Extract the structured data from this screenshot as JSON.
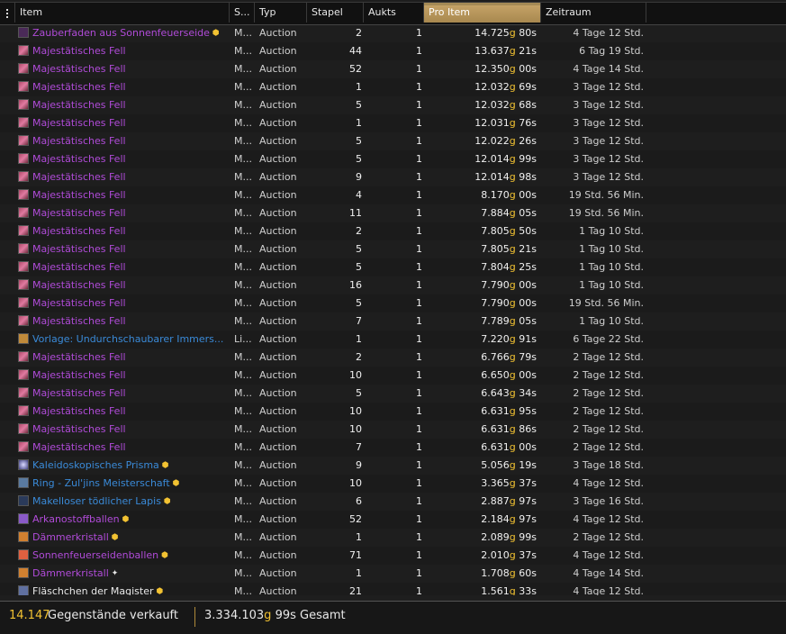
{
  "columns": {
    "item": "Item",
    "s": "S...",
    "typ": "Typ",
    "stapel": "Stapel",
    "aukts": "Aukts",
    "pro_item": "Pro Item",
    "zeitraum": "Zeitraum"
  },
  "gold_symbol": "g",
  "rows": [
    {
      "name": "Zauberfaden aus Sonnenfeuerseide",
      "quality": "epic",
      "icon": "thread-icon",
      "star": "gold",
      "s": "M...",
      "typ": "Auction",
      "stapel": "2",
      "aukts": "1",
      "gold": "14.725",
      "silver": "80s",
      "zeit": "4 Tage 12 Std."
    },
    {
      "name": "Majestätisches Fell",
      "quality": "epic",
      "icon": "fur-icon",
      "star": "",
      "s": "M...",
      "typ": "Auction",
      "stapel": "44",
      "aukts": "1",
      "gold": "13.637",
      "silver": "21s",
      "zeit": "6 Tag 19 Std."
    },
    {
      "name": "Majestätisches Fell",
      "quality": "epic",
      "icon": "fur-icon",
      "star": "",
      "s": "M...",
      "typ": "Auction",
      "stapel": "52",
      "aukts": "1",
      "gold": "12.350",
      "silver": "00s",
      "zeit": "4 Tage 14 Std."
    },
    {
      "name": "Majestätisches Fell",
      "quality": "epic",
      "icon": "fur-icon",
      "star": "",
      "s": "M...",
      "typ": "Auction",
      "stapel": "1",
      "aukts": "1",
      "gold": "12.032",
      "silver": "69s",
      "zeit": "3 Tage 12 Std."
    },
    {
      "name": "Majestätisches Fell",
      "quality": "epic",
      "icon": "fur-icon",
      "star": "",
      "s": "M...",
      "typ": "Auction",
      "stapel": "5",
      "aukts": "1",
      "gold": "12.032",
      "silver": "68s",
      "zeit": "3 Tage 12 Std."
    },
    {
      "name": "Majestätisches Fell",
      "quality": "epic",
      "icon": "fur-icon",
      "star": "",
      "s": "M...",
      "typ": "Auction",
      "stapel": "1",
      "aukts": "1",
      "gold": "12.031",
      "silver": "76s",
      "zeit": "3 Tage 12 Std."
    },
    {
      "name": "Majestätisches Fell",
      "quality": "epic",
      "icon": "fur-icon",
      "star": "",
      "s": "M...",
      "typ": "Auction",
      "stapel": "5",
      "aukts": "1",
      "gold": "12.022",
      "silver": "26s",
      "zeit": "3 Tage 12 Std."
    },
    {
      "name": "Majestätisches Fell",
      "quality": "epic",
      "icon": "fur-icon",
      "star": "",
      "s": "M...",
      "typ": "Auction",
      "stapel": "5",
      "aukts": "1",
      "gold": "12.014",
      "silver": "99s",
      "zeit": "3 Tage 12 Std."
    },
    {
      "name": "Majestätisches Fell",
      "quality": "epic",
      "icon": "fur-icon",
      "star": "",
      "s": "M...",
      "typ": "Auction",
      "stapel": "9",
      "aukts": "1",
      "gold": "12.014",
      "silver": "98s",
      "zeit": "3 Tage 12 Std."
    },
    {
      "name": "Majestätisches Fell",
      "quality": "epic",
      "icon": "fur-icon",
      "star": "",
      "s": "M...",
      "typ": "Auction",
      "stapel": "4",
      "aukts": "1",
      "gold": "8.170",
      "silver": "00s",
      "zeit": "19 Std. 56 Min."
    },
    {
      "name": "Majestätisches Fell",
      "quality": "epic",
      "icon": "fur-icon",
      "star": "",
      "s": "M...",
      "typ": "Auction",
      "stapel": "11",
      "aukts": "1",
      "gold": "7.884",
      "silver": "05s",
      "zeit": "19 Std. 56 Min."
    },
    {
      "name": "Majestätisches Fell",
      "quality": "epic",
      "icon": "fur-icon",
      "star": "",
      "s": "M...",
      "typ": "Auction",
      "stapel": "2",
      "aukts": "1",
      "gold": "7.805",
      "silver": "50s",
      "zeit": "1 Tag 10 Std."
    },
    {
      "name": "Majestätisches Fell",
      "quality": "epic",
      "icon": "fur-icon",
      "star": "",
      "s": "M...",
      "typ": "Auction",
      "stapel": "5",
      "aukts": "1",
      "gold": "7.805",
      "silver": "21s",
      "zeit": "1 Tag 10 Std."
    },
    {
      "name": "Majestätisches Fell",
      "quality": "epic",
      "icon": "fur-icon",
      "star": "",
      "s": "M...",
      "typ": "Auction",
      "stapel": "5",
      "aukts": "1",
      "gold": "7.804",
      "silver": "25s",
      "zeit": "1 Tag 10 Std."
    },
    {
      "name": "Majestätisches Fell",
      "quality": "epic",
      "icon": "fur-icon",
      "star": "",
      "s": "M...",
      "typ": "Auction",
      "stapel": "16",
      "aukts": "1",
      "gold": "7.790",
      "silver": "00s",
      "zeit": "1 Tag 10 Std."
    },
    {
      "name": "Majestätisches Fell",
      "quality": "epic",
      "icon": "fur-icon",
      "star": "",
      "s": "M...",
      "typ": "Auction",
      "stapel": "5",
      "aukts": "1",
      "gold": "7.790",
      "silver": "00s",
      "zeit": "19 Std. 56 Min."
    },
    {
      "name": "Majestätisches Fell",
      "quality": "epic",
      "icon": "fur-icon",
      "star": "",
      "s": "M...",
      "typ": "Auction",
      "stapel": "7",
      "aukts": "1",
      "gold": "7.789",
      "silver": "05s",
      "zeit": "1 Tag 10 Std."
    },
    {
      "name": "Vorlage: Undurchschaubarer Immers...",
      "quality": "rare",
      "icon": "recipe-icon",
      "star": "",
      "s": "Li...",
      "typ": "Auction",
      "stapel": "1",
      "aukts": "1",
      "gold": "7.220",
      "silver": "91s",
      "zeit": "6 Tage 22 Std."
    },
    {
      "name": "Majestätisches Fell",
      "quality": "epic",
      "icon": "fur-icon",
      "star": "",
      "s": "M...",
      "typ": "Auction",
      "stapel": "2",
      "aukts": "1",
      "gold": "6.766",
      "silver": "79s",
      "zeit": "2 Tage 12 Std."
    },
    {
      "name": "Majestätisches Fell",
      "quality": "epic",
      "icon": "fur-icon",
      "star": "",
      "s": "M...",
      "typ": "Auction",
      "stapel": "10",
      "aukts": "1",
      "gold": "6.650",
      "silver": "00s",
      "zeit": "2 Tage 12 Std."
    },
    {
      "name": "Majestätisches Fell",
      "quality": "epic",
      "icon": "fur-icon",
      "star": "",
      "s": "M...",
      "typ": "Auction",
      "stapel": "5",
      "aukts": "1",
      "gold": "6.643",
      "silver": "34s",
      "zeit": "2 Tage 12 Std."
    },
    {
      "name": "Majestätisches Fell",
      "quality": "epic",
      "icon": "fur-icon",
      "star": "",
      "s": "M...",
      "typ": "Auction",
      "stapel": "10",
      "aukts": "1",
      "gold": "6.631",
      "silver": "95s",
      "zeit": "2 Tage 12 Std."
    },
    {
      "name": "Majestätisches Fell",
      "quality": "epic",
      "icon": "fur-icon",
      "star": "",
      "s": "M...",
      "typ": "Auction",
      "stapel": "10",
      "aukts": "1",
      "gold": "6.631",
      "silver": "86s",
      "zeit": "2 Tage 12 Std."
    },
    {
      "name": "Majestätisches Fell",
      "quality": "epic",
      "icon": "fur-icon",
      "star": "",
      "s": "M...",
      "typ": "Auction",
      "stapel": "7",
      "aukts": "1",
      "gold": "6.631",
      "silver": "00s",
      "zeit": "2 Tage 12 Std."
    },
    {
      "name": "Kaleidoskopisches Prisma",
      "quality": "rare",
      "icon": "prism-icon",
      "star": "gold",
      "s": "M...",
      "typ": "Auction",
      "stapel": "9",
      "aukts": "1",
      "gold": "5.056",
      "silver": "19s",
      "zeit": "3 Tage 18 Std."
    },
    {
      "name": "Ring - Zul'jins Meisterschaft",
      "quality": "rare",
      "icon": "ring-icon",
      "star": "gold",
      "s": "M...",
      "typ": "Auction",
      "stapel": "10",
      "aukts": "1",
      "gold": "3.365",
      "silver": "37s",
      "zeit": "4 Tage 12 Std."
    },
    {
      "name": "Makelloser tödlicher Lapis",
      "quality": "rare",
      "icon": "gem-icon",
      "star": "gold",
      "s": "M...",
      "typ": "Auction",
      "stapel": "6",
      "aukts": "1",
      "gold": "2.887",
      "silver": "97s",
      "zeit": "3 Tage 16 Std."
    },
    {
      "name": "Arkanostoffballen",
      "quality": "epic",
      "icon": "cloth-icon",
      "star": "gold",
      "s": "M...",
      "typ": "Auction",
      "stapel": "52",
      "aukts": "1",
      "gold": "2.184",
      "silver": "97s",
      "zeit": "4 Tage 12 Std."
    },
    {
      "name": "Dämmerkristall",
      "quality": "epic",
      "icon": "crystal-icon",
      "star": "gold",
      "s": "M...",
      "typ": "Auction",
      "stapel": "1",
      "aukts": "1",
      "gold": "2.089",
      "silver": "99s",
      "zeit": "2 Tage 12 Std."
    },
    {
      "name": "Sonnenfeuerseidenballen",
      "quality": "epic",
      "icon": "cloth2-icon",
      "star": "gold",
      "s": "M...",
      "typ": "Auction",
      "stapel": "71",
      "aukts": "1",
      "gold": "2.010",
      "silver": "37s",
      "zeit": "4 Tage 12 Std."
    },
    {
      "name": "Dämmerkristall",
      "quality": "epic",
      "icon": "crystal-icon",
      "star": "white",
      "s": "M...",
      "typ": "Auction",
      "stapel": "1",
      "aukts": "1",
      "gold": "1.708",
      "silver": "60s",
      "zeit": "4 Tage 14 Std."
    },
    {
      "name": "Fläschchen der Magister",
      "quality": "common",
      "icon": "flask-icon",
      "star": "gold",
      "s": "M...",
      "typ": "Auction",
      "stapel": "21",
      "aukts": "1",
      "gold": "1.561",
      "silver": "33s",
      "zeit": "4 Tage 12 Std."
    }
  ],
  "footer": {
    "sold_count": "14.147",
    "sold_label": "Gegenstände verkauft",
    "total_gold": "3.334.103",
    "total_silver": "99s",
    "total_label": "Gesamt"
  },
  "colors": {
    "epic": "#b04bd8",
    "rare": "#3a8ad8",
    "gold": "#f2c232",
    "active_header": "#c4a266"
  }
}
